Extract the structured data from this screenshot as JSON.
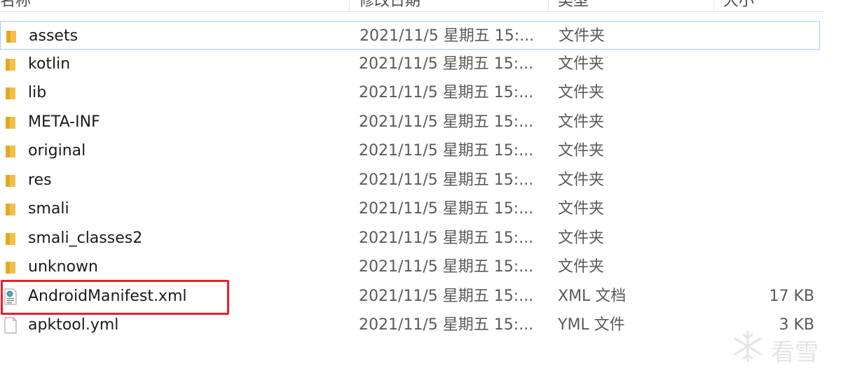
{
  "columns": {
    "name": "名称",
    "date": "修改日期",
    "type": "类型",
    "size": "大小"
  },
  "files": [
    {
      "name": "assets",
      "date": "2021/11/5 星期五 15:...",
      "type": "文件夹",
      "size": "",
      "icon": "folder-icon"
    },
    {
      "name": "kotlin",
      "date": "2021/11/5 星期五 15:...",
      "type": "文件夹",
      "size": "",
      "icon": "folder-icon"
    },
    {
      "name": "lib",
      "date": "2021/11/5 星期五 15:...",
      "type": "文件夹",
      "size": "",
      "icon": "folder-icon"
    },
    {
      "name": "META-INF",
      "date": "2021/11/5 星期五 15:...",
      "type": "文件夹",
      "size": "",
      "icon": "folder-icon"
    },
    {
      "name": "original",
      "date": "2021/11/5 星期五 15:...",
      "type": "文件夹",
      "size": "",
      "icon": "folder-icon"
    },
    {
      "name": "res",
      "date": "2021/11/5 星期五 15:...",
      "type": "文件夹",
      "size": "",
      "icon": "folder-icon"
    },
    {
      "name": "smali",
      "date": "2021/11/5 星期五 15:...",
      "type": "文件夹",
      "size": "",
      "icon": "folder-icon"
    },
    {
      "name": "smali_classes2",
      "date": "2021/11/5 星期五 15:...",
      "type": "文件夹",
      "size": "",
      "icon": "folder-icon"
    },
    {
      "name": "unknown",
      "date": "2021/11/5 星期五 15:...",
      "type": "文件夹",
      "size": "",
      "icon": "folder-icon"
    },
    {
      "name": "AndroidManifest.xml",
      "date": "2021/11/5 星期五 15:...",
      "type": "XML 文档",
      "size": "17 KB",
      "icon": "xml-file-icon"
    },
    {
      "name": "apktool.yml",
      "date": "2021/11/5 星期五 15:...",
      "type": "YML 文件",
      "size": "3 KB",
      "icon": "blank-file-icon"
    }
  ],
  "watermark": {
    "text": "看雪",
    "icon": "snowflake-icon"
  },
  "colors": {
    "highlight": "#e8202a",
    "focus_border": "#99d1ff",
    "folder": "#f2c04a"
  }
}
